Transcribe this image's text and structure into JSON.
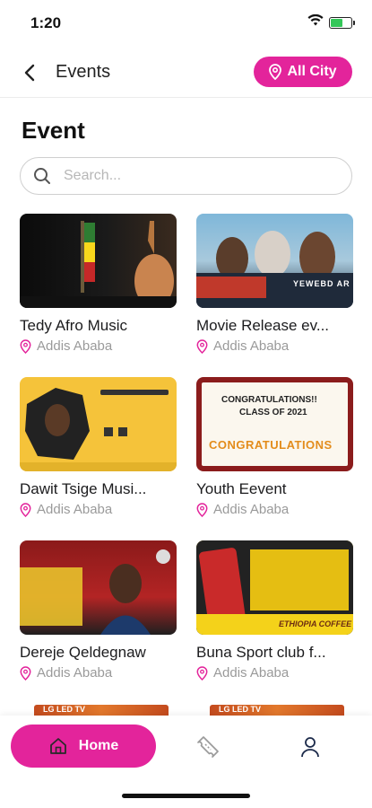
{
  "status_bar": {
    "time": "1:20"
  },
  "header": {
    "title": "Events",
    "city_button_label": "All City"
  },
  "page": {
    "title": "Event"
  },
  "search": {
    "placeholder": "Search..."
  },
  "events": [
    {
      "title": "Tedy Afro Music",
      "location": "Addis Ababa"
    },
    {
      "title": "Movie Release ev...",
      "location": "Addis Ababa"
    },
    {
      "title": "Dawit Tsige Musi...",
      "location": "Addis Ababa"
    },
    {
      "title": "Youth Eevent",
      "location": "Addis Ababa"
    },
    {
      "title": "Dereje Qeldegnaw",
      "location": "Addis Ababa"
    },
    {
      "title": "Buna Sport club f...",
      "location": "Addis Ababa"
    }
  ],
  "thumbnail_text": {
    "youth_line1": "CONGRATULATIONS!!",
    "youth_line2": "CLASS OF 2021",
    "youth_banner": "CONGRATULATIONS",
    "movie_text": "YEWEBD AR",
    "buna_text": "ETHIOPIA COFFEE",
    "peek_text": "LG LED TV"
  },
  "tabbar": {
    "home_label": "Home"
  },
  "colors": {
    "accent": "#e3249b",
    "muted": "#9a9a9a"
  }
}
